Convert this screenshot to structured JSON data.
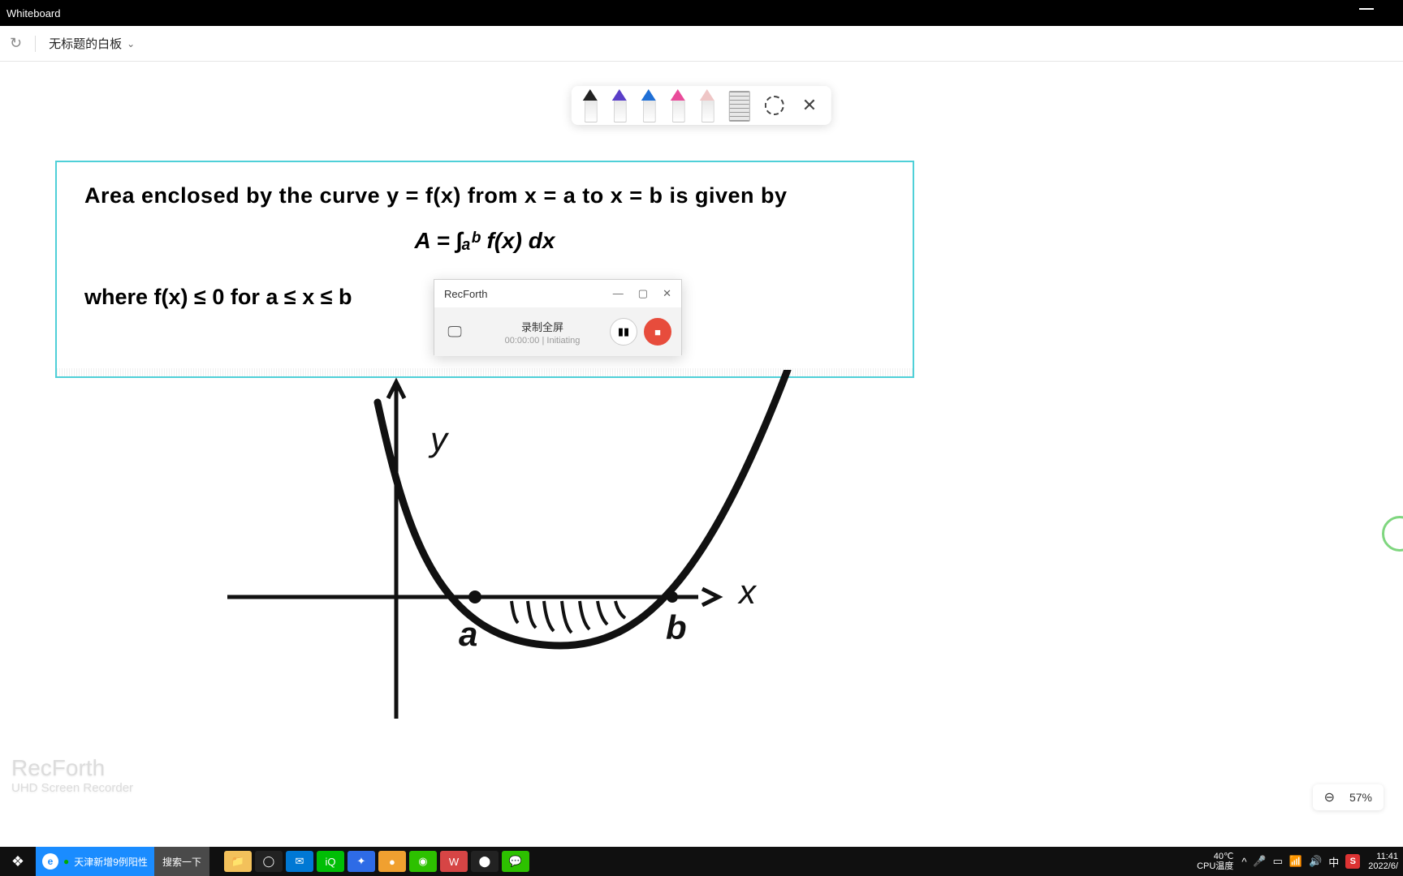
{
  "window": {
    "app_title": "Whiteboard"
  },
  "toolbar": {
    "board_title": "无标题的白板"
  },
  "pens": [
    {
      "name": "black-pen",
      "tip": "#222222"
    },
    {
      "name": "purple-pen",
      "tip": "#5a3ec8"
    },
    {
      "name": "blue-pen",
      "tip": "#1f6fd6"
    },
    {
      "name": "pink-highlighter",
      "tip": "#e94b9a"
    },
    {
      "name": "eraser",
      "tip": "#efc6c6"
    }
  ],
  "content": {
    "line1": "Area enclosed by the curve y = f(x) from x = a to x = b is given by",
    "equation": "A = ∫ₐᵇ  f(x) dx",
    "line2_prefix": "where f(x) ≤ 0 for a ≤ x ≤ b",
    "graph_labels": {
      "y": "y",
      "x": "x",
      "a": "a",
      "b": "b"
    }
  },
  "recforth": {
    "title": "RecForth",
    "mode": "录制全屏",
    "time": "00:00:00",
    "status_sep": "|",
    "status": "Initiating"
  },
  "watermark": {
    "name": "RecForth",
    "sub": "UHD Screen Recorder"
  },
  "zoom": {
    "value": "57%"
  },
  "taskbar": {
    "ie_text": "天津新增9例阳性",
    "search": "搜索一下",
    "apps": [
      {
        "name": "file-explorer",
        "bg": "#f3c15b",
        "glyph": "📁"
      },
      {
        "name": "cortana",
        "bg": "#222",
        "glyph": "◯"
      },
      {
        "name": "mail",
        "bg": "#0078d4",
        "glyph": "✉"
      },
      {
        "name": "iqiyi",
        "bg": "#00be06",
        "glyph": "iQ"
      },
      {
        "name": "feishu",
        "bg": "#2e6be6",
        "glyph": "✦"
      },
      {
        "name": "app6",
        "bg": "#f0a030",
        "glyph": "●"
      },
      {
        "name": "wechat-work",
        "bg": "#2dc100",
        "glyph": "◉"
      },
      {
        "name": "wps",
        "bg": "#d64545",
        "glyph": "W"
      },
      {
        "name": "recforth-app",
        "bg": "#222",
        "glyph": "⬤"
      },
      {
        "name": "wechat",
        "bg": "#2dc100",
        "glyph": "💬"
      }
    ],
    "temp": "40℃",
    "temp_label": "CPU温度",
    "ime": "中",
    "ime_badge": "S",
    "time": "11:41",
    "date": "2022/6/"
  }
}
